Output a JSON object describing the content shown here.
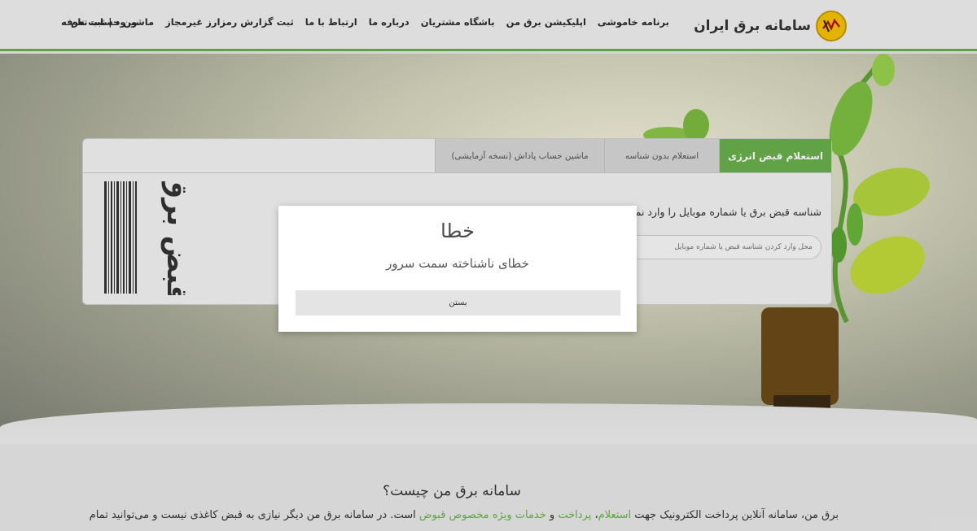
{
  "header": {
    "brand_title": "سامانه برق ایران",
    "nav": [
      "برنامه خاموشی",
      "اپلیکیشن برق من",
      "باشگاه مشتریان",
      "درباره ما",
      "ارتباط با ما",
      "ثبت گزارش رمزارز غیرمجاز",
      "ماشین حساب تعرفه"
    ],
    "login": "ورود",
    "separator": "|",
    "register": "ثبت نام"
  },
  "card": {
    "tabs": [
      "استعلام قبض انرژی",
      "استعلام بدون شناسه",
      "ماشین حساب پاداش (نسخه آزمایشی)"
    ],
    "instruction": "شناسه قبض برق یا شماره موبایل را وارد نمایید",
    "input_placeholder": "محل وارد کردن شناسه قبض یا شماره موبایل",
    "bill_label": "قبض برق"
  },
  "modal": {
    "title": "خطا",
    "message": "خطای ناشناخته سمت سرور",
    "close_label": "بستن"
  },
  "about": {
    "title": "سامانه برق من چیست؟",
    "p1": "برق من، سامانه آنلاین پرداخت الکترونیک جهت ",
    "link1": "استعلام",
    "comma": "، ",
    "link2": "پرداخت",
    "and": " و ",
    "link3": "خدمات ویژه مخصوص قبوض",
    "p2": " است. در سامانه برق من دیگر نیازی به قبض کاغذی نیست و می‌توانید تمام"
  },
  "colors": {
    "accent": "#6ab04c",
    "logo": "#f6c400"
  }
}
